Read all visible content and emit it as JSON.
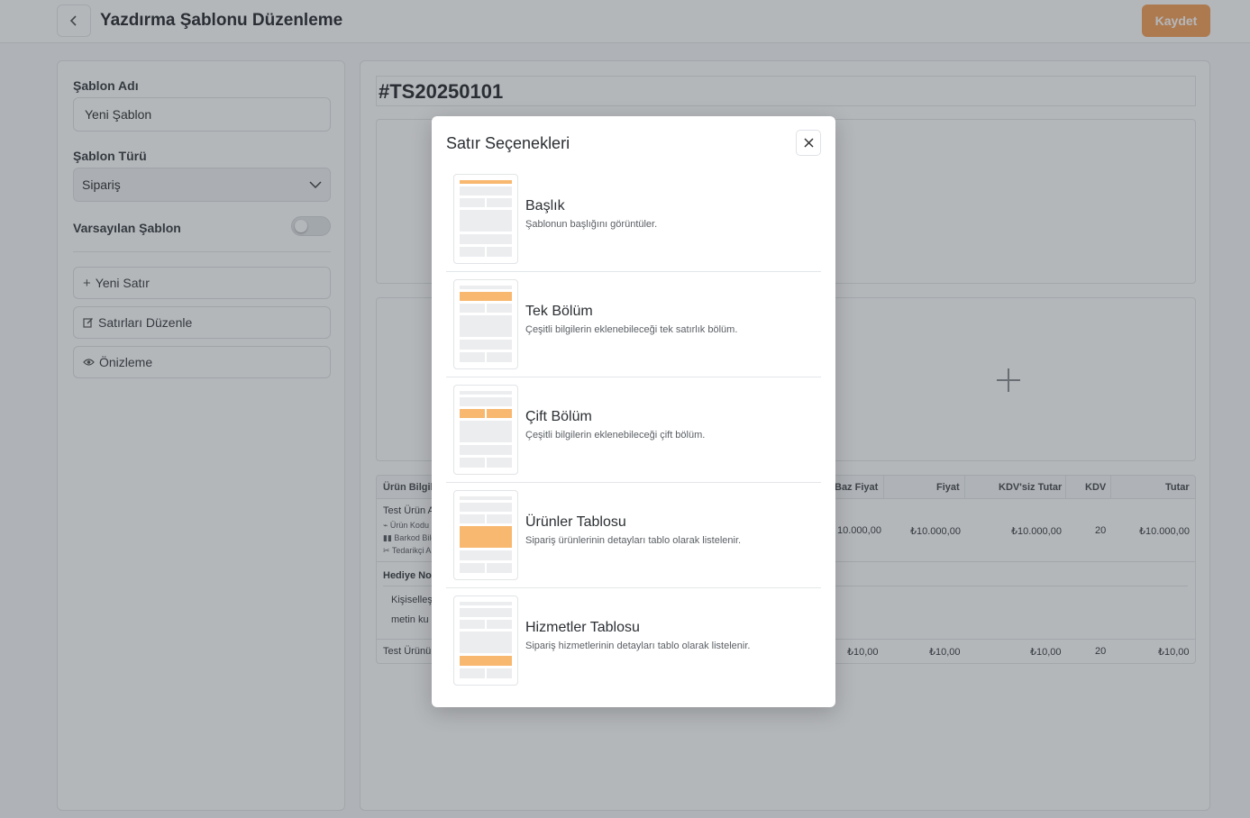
{
  "header": {
    "title": "Yazdırma Şablonu Düzenleme",
    "save_label": "Kaydet"
  },
  "form": {
    "name_label": "Şablon Adı",
    "name_value": "Yeni Şablon",
    "type_label": "Şablon Türü",
    "type_value": "Sipariş",
    "default_label": "Varsayılan Şablon",
    "default_on": false,
    "buttons": {
      "new_row": "Yeni Satır",
      "edit_rows": "Satırları Düzenle",
      "preview": "Önizleme"
    }
  },
  "document": {
    "number": "#TS20250101",
    "table": {
      "headers": {
        "product_info": "Ürün Bilgil",
        "base_price": "Baz Fiyat",
        "price": "Fiyat",
        "net_total": "KDV'siz Tutar",
        "vat": "KDV",
        "total": "Tutar"
      },
      "row1": {
        "name": "Test Ürün A",
        "code": "Ürün Kodu",
        "barcode": "Barkod Bilg",
        "supplier": "Tedarikçi A",
        "base_price": "10.000,00",
        "price": "₺10.000,00",
        "net_total": "₺10.000,00",
        "vat": "20",
        "total": "₺10.000,00"
      },
      "gift_note": {
        "title": "Hediye No",
        "line1": "Kişiselleş",
        "line2": "metin ku"
      },
      "row2": {
        "name": "Test Ürünü",
        "base_price": "₺10,00",
        "price": "₺10,00",
        "net_total": "₺10,00",
        "vat": "20",
        "total": "₺10,00"
      }
    }
  },
  "modal": {
    "title": "Satır Seçenekleri",
    "options": [
      {
        "title": "Başlık",
        "desc": "Şablonun başlığını görüntüler."
      },
      {
        "title": "Tek Bölüm",
        "desc": "Çeşitli bilgilerin eklenebileceği tek satırlık bölüm."
      },
      {
        "title": "Çift Bölüm",
        "desc": "Çeşitli bilgilerin eklenebileceği çift bölüm."
      },
      {
        "title": "Ürünler Tablosu",
        "desc": "Sipariş ürünlerinin detayları tablo olarak listelenir."
      },
      {
        "title": "Hizmetler Tablosu",
        "desc": "Sipariş hizmetlerinin detayları tablo olarak listelenir."
      }
    ]
  },
  "colors": {
    "accent": "#f5a25d",
    "highlight": "#f8b86f"
  }
}
